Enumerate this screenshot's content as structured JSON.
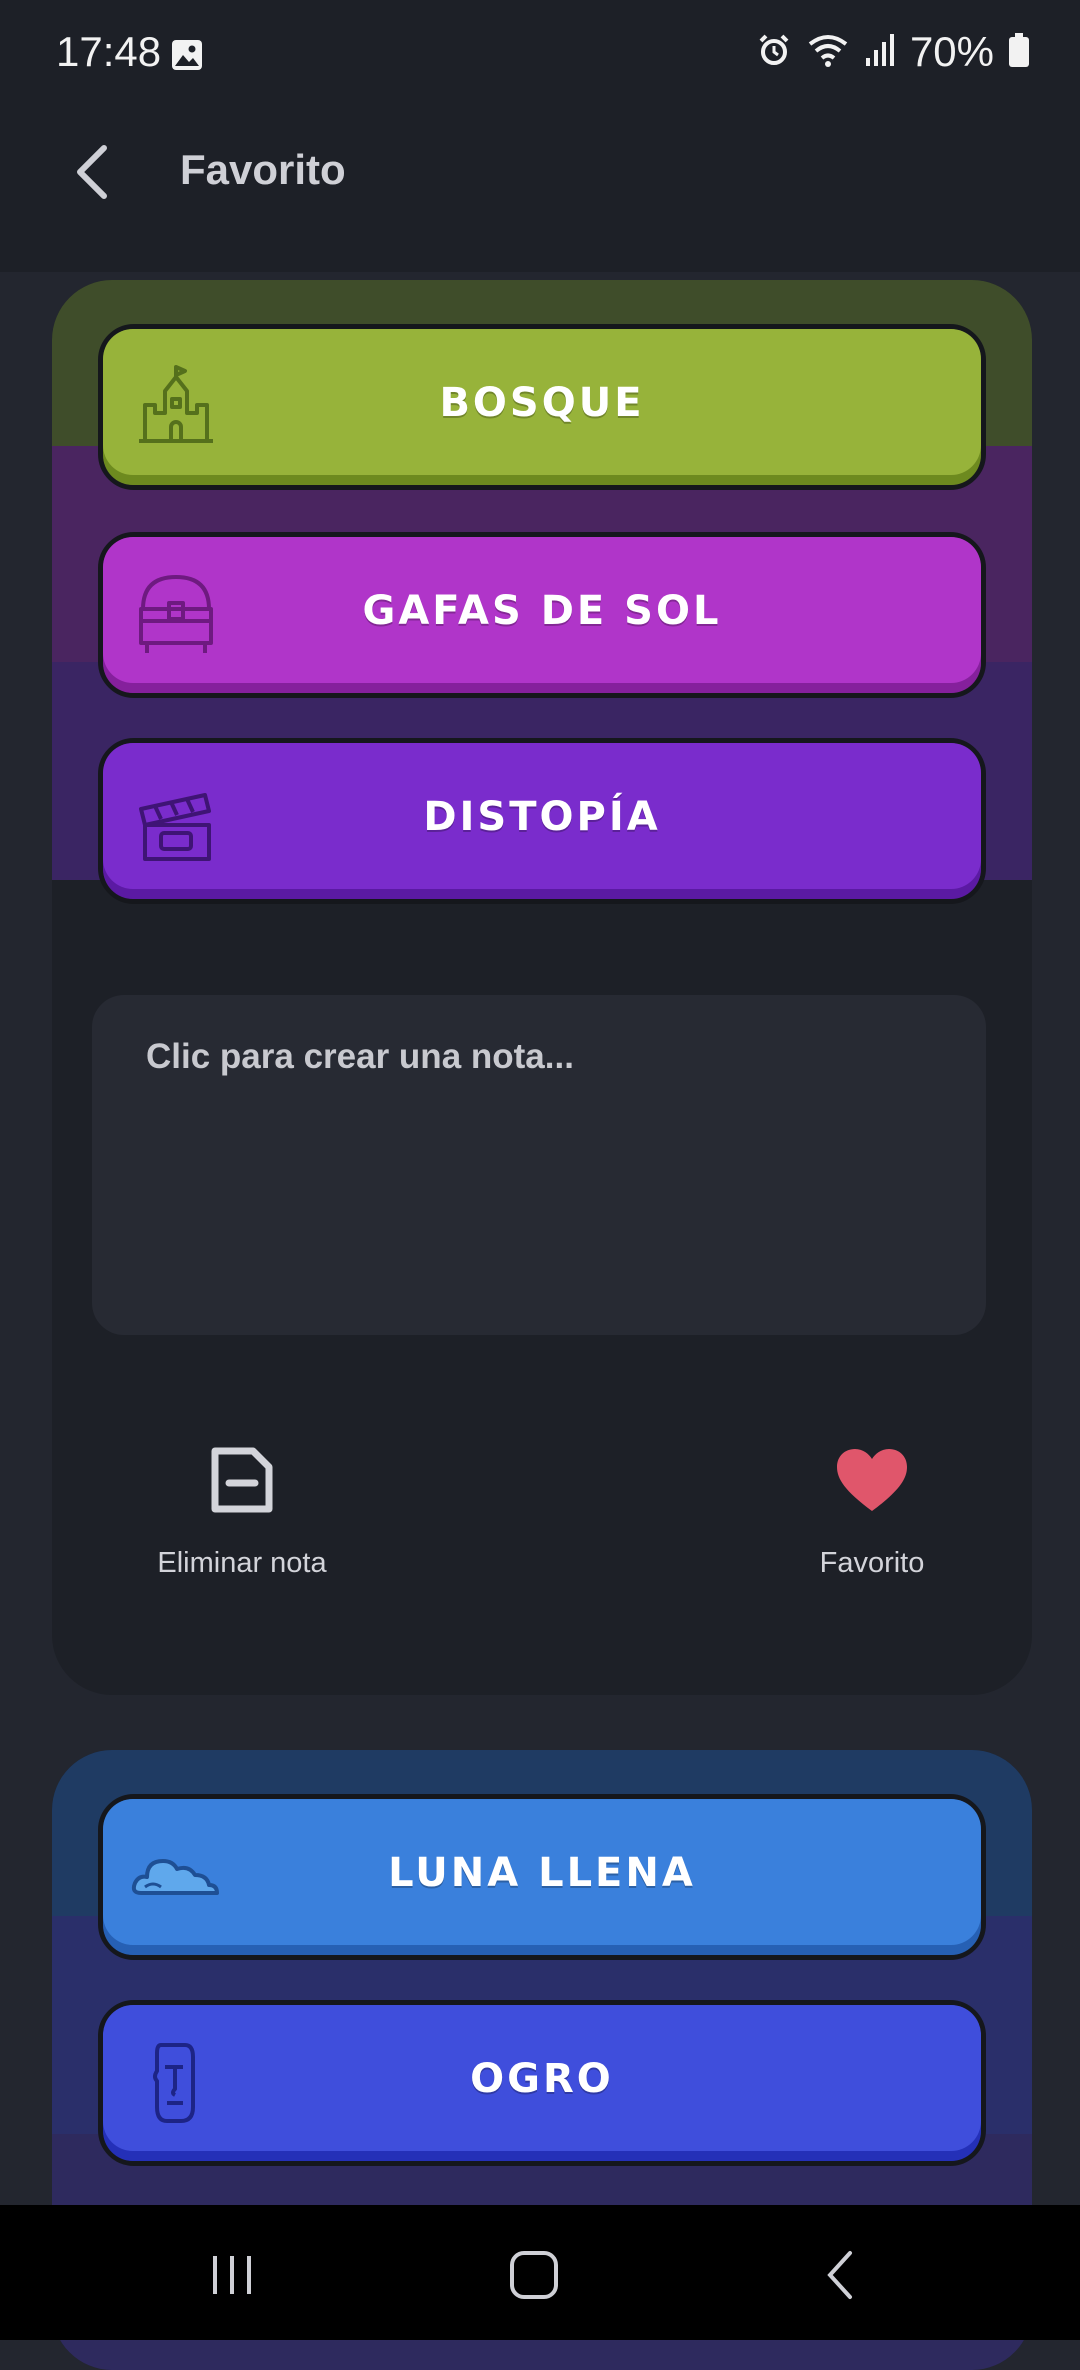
{
  "status_bar": {
    "time": "17:48",
    "battery": "70%"
  },
  "app_bar": {
    "title": "Favorito"
  },
  "card1": {
    "categories": [
      {
        "label": "BOSQUE",
        "icon": "castle-icon",
        "color": "#97b33a",
        "band": "#3f4d2a"
      },
      {
        "label": "GAFAS DE SOL",
        "icon": "treasure-chest-icon",
        "color": "#b035c9",
        "band": "#4a2560"
      },
      {
        "label": "DISTOPÍA",
        "icon": "clapperboard-icon",
        "color": "#7a2ccc",
        "band": "#3a2563"
      }
    ],
    "note_placeholder": "Clic para crear una nota...",
    "actions": {
      "delete_label": "Eliminar nota",
      "favorite_label": "Favorito"
    },
    "favorite_color": "#e0566b"
  },
  "card2": {
    "categories": [
      {
        "label": "LUNA LLENA",
        "icon": "cloud-icon",
        "color": "#3a80dc",
        "band": "#1f3b63"
      },
      {
        "label": "OGRO",
        "icon": "moai-icon",
        "color": "#3f4edc",
        "band": "#2a2f6a"
      }
    ]
  }
}
